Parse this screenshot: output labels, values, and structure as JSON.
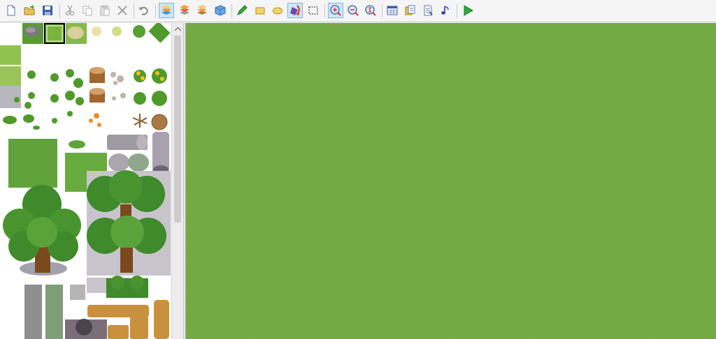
{
  "toolbar": {
    "icons": [
      "new-project-icon",
      "open-project-icon",
      "save-project-icon",
      "cut-icon",
      "copy-icon",
      "paste-icon",
      "delete-icon",
      "undo-icon",
      "layer-lower-icon",
      "layer-upper-icon",
      "layer-event-icon",
      "layer-region-icon",
      "pencil-icon",
      "rectangle-icon",
      "ellipse-icon",
      "flood-fill-icon",
      "shadow-pen-icon",
      "zoom-in-icon",
      "zoom-out-icon",
      "zoom-actual-icon",
      "database-icon",
      "resource-manager-icon",
      "script-editor-icon",
      "sound-test-icon",
      "playtest-icon"
    ],
    "active": [
      "layer-lower-icon",
      "flood-fill-icon",
      "zoom-in-icon"
    ]
  },
  "colors": {
    "toolbar_bg": "#f5f5f5",
    "active_bg": "#cde6f7",
    "grass_base": "#6aa733",
    "panel_bg": "#ffffff",
    "scrollbar_thumb": "#cdcdcd"
  }
}
